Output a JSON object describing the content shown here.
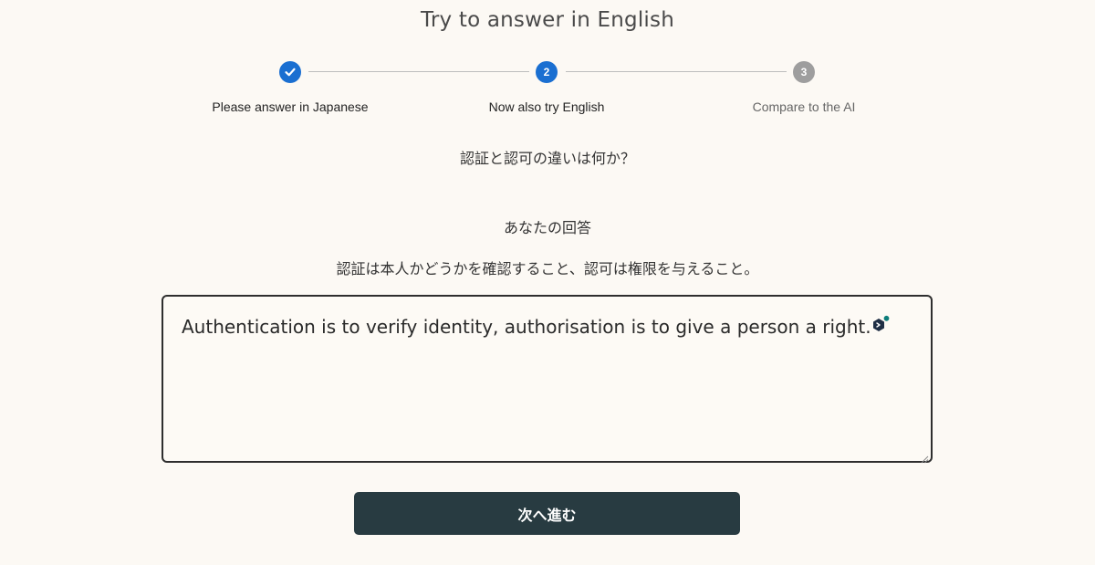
{
  "page": {
    "title": "Try to answer in English"
  },
  "stepper": {
    "steps": [
      {
        "label": "Please answer in Japanese",
        "number": "1",
        "state": "done"
      },
      {
        "label": "Now also try English",
        "number": "2",
        "state": "active"
      },
      {
        "label": "Compare to the AI",
        "number": "3",
        "state": "pending"
      }
    ]
  },
  "question": {
    "text": "認証と認可の違いは何か？"
  },
  "answer": {
    "heading": "あなたの回答",
    "japanese_text": "認証は本人かどうかを確認すること、認可は権限を与えること。",
    "english_value": "Authentication is to verify identity, authorisation is to give a person a right.",
    "assist_icon": "grammar-assistant-icon"
  },
  "actions": {
    "next_label": "次へ進む"
  },
  "colors": {
    "background": "#fcf9f4",
    "accent_blue": "#1a6fd1",
    "pending_gray": "#9e9e9e",
    "button_dark": "#283b41",
    "assist_teal": "#0d7d7a"
  }
}
